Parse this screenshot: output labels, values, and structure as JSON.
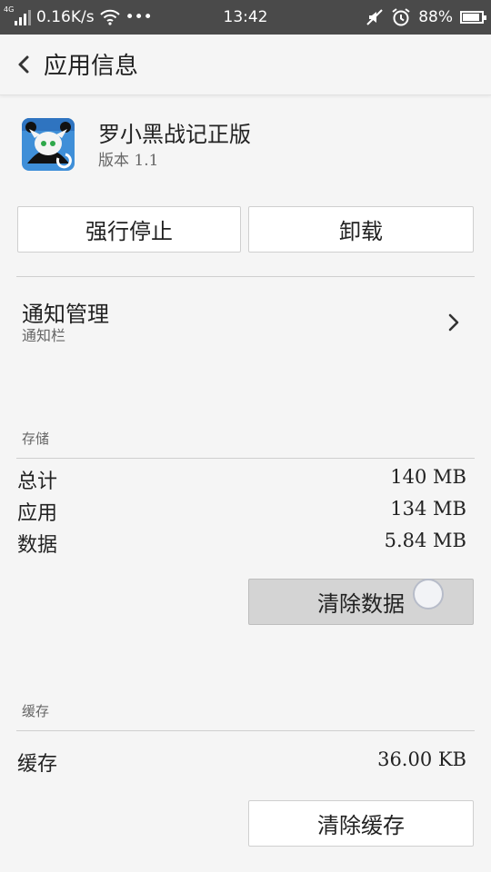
{
  "status_bar": {
    "network_type": "4G",
    "speed": "0.16K/s",
    "more": "•••",
    "time": "13:42",
    "battery_percent": "88%",
    "battery_level": 0.88
  },
  "header": {
    "title": "应用信息"
  },
  "app": {
    "name": "罗小黑战记正版",
    "version": "版本 1.1"
  },
  "actions": {
    "force_stop": "强行停止",
    "uninstall": "卸载"
  },
  "notification": {
    "title": "通知管理",
    "subtitle": "通知栏"
  },
  "storage": {
    "section_label": "存储",
    "rows": [
      {
        "label": "总计",
        "value": "140 MB"
      },
      {
        "label": "应用",
        "value": "134 MB"
      },
      {
        "label": "数据",
        "value": "5.84 MB"
      }
    ],
    "clear_button": "清除数据"
  },
  "cache": {
    "section_label": "缓存",
    "label": "缓存",
    "value": "36.00 KB",
    "clear_button": "清除缓存"
  },
  "colors": {
    "status_bar_bg": "#4a4a4a",
    "page_bg": "#f5f5f5",
    "button_bg": "#ffffff",
    "pressed_button_bg": "#d4d4d4"
  }
}
